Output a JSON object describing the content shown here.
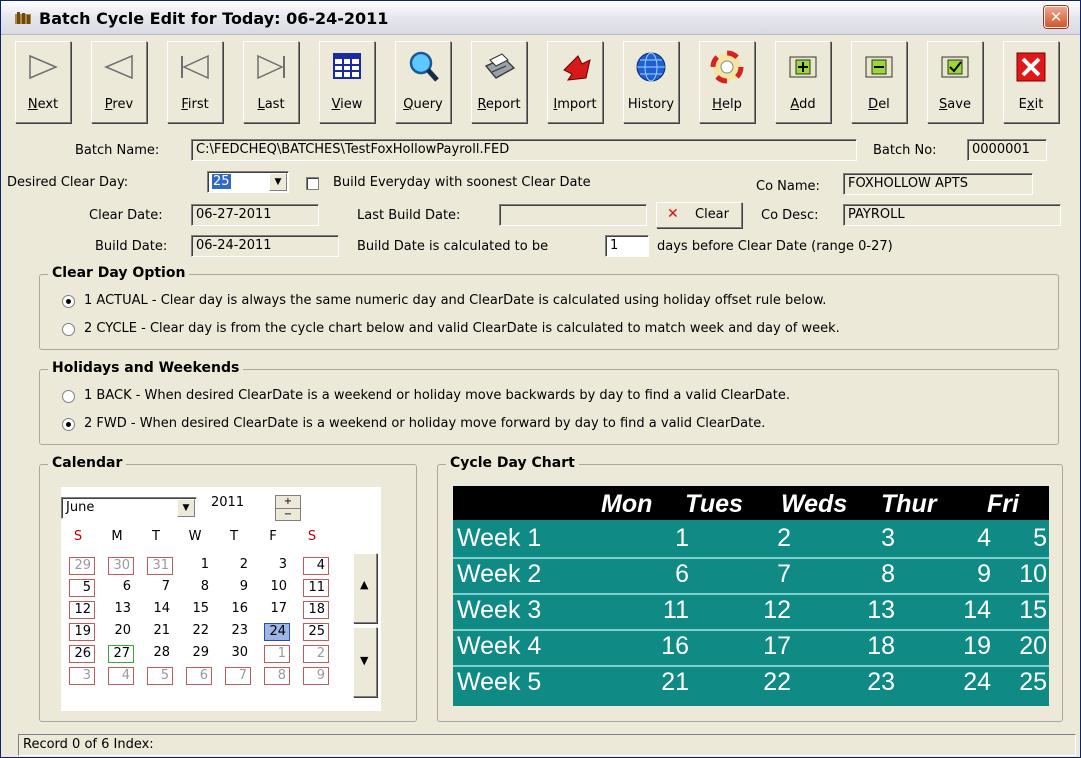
{
  "window": {
    "title": "Batch Cycle Edit for Today: 06-24-2011",
    "close_glyph": "✕"
  },
  "toolbar": [
    {
      "key": "N",
      "rest": "ext",
      "icon": "next-icon"
    },
    {
      "key": "P",
      "rest": "rev",
      "icon": "prev-icon"
    },
    {
      "key": "F",
      "rest": "irst",
      "icon": "first-icon"
    },
    {
      "key": "L",
      "rest": "ast",
      "icon": "last-icon"
    },
    {
      "key": "V",
      "rest": "iew",
      "icon": "grid-view-icon"
    },
    {
      "key": "Q",
      "rest": "uery",
      "icon": "magnifier-icon"
    },
    {
      "key": "R",
      "rest": "eport",
      "icon": "printer-icon"
    },
    {
      "key": "I",
      "rest": "mport",
      "icon": "import-arrow-icon"
    },
    {
      "key": "",
      "rest": "History",
      "icon": "globe-icon"
    },
    {
      "key": "H",
      "rest": "elp",
      "icon": "lifebuoy-icon"
    },
    {
      "key": "A",
      "rest": "dd",
      "icon": "add-folder-icon"
    },
    {
      "key": "D",
      "rest": "el",
      "icon": "delete-folder-icon"
    },
    {
      "key": "S",
      "rest": "ave",
      "icon": "save-check-icon"
    },
    {
      "pre": "E",
      "key": "x",
      "rest": "it",
      "icon": "exit-x-icon"
    }
  ],
  "form": {
    "batch_name_label": "Batch Name:",
    "batch_name": "C:\\FEDCHEQ\\BATCHES\\TestFoxHollowPayroll.FED",
    "batch_no_label": "Batch No:",
    "batch_no": "0000001",
    "desired_clear_day_label": "Desired Clear Day:",
    "desired_clear_day": "25",
    "build_everyday_label": "Build Everyday with soonest Clear Date",
    "co_name_label": "Co Name:",
    "co_name": "FOXHOLLOW APTS",
    "clear_date_label": "Clear Date:",
    "clear_date": "06-27-2011",
    "last_build_date_label": "Last Build Date:",
    "last_build_date": "",
    "clear_button": "Clear",
    "co_desc_label": "Co Desc:",
    "co_desc": "PAYROLL",
    "build_date_label": "Build Date:",
    "build_date": "06-24-2011",
    "build_calc_label": "Build Date is calculated to be",
    "build_days": "1",
    "build_days_suffix": "days before Clear Date (range 0-27)"
  },
  "clear_day_option": {
    "title": "Clear Day Option",
    "options": [
      {
        "text": "1 ACTUAL - Clear day is always the same numeric day and ClearDate is calculated using holiday offset rule below.",
        "selected": true
      },
      {
        "text": "2 CYCLE - Clear day is from the cycle chart below and valid ClearDate is calculated to match week and day of week.",
        "selected": false
      }
    ]
  },
  "holidays": {
    "title": "Holidays and Weekends",
    "options": [
      {
        "text": "1 BACK - When desired ClearDate is a weekend or holiday move backwards by day to find a valid ClearDate.",
        "selected": false
      },
      {
        "text": "2 FWD - When desired ClearDate is a weekend or holiday move forward by day to find a valid ClearDate.",
        "selected": true
      }
    ]
  },
  "calendar": {
    "title": "Calendar",
    "month": "June",
    "year": "2011",
    "day_headers": [
      "S",
      "M",
      "T",
      "W",
      "T",
      "F",
      "S"
    ],
    "weeks": [
      [
        "29",
        "30",
        "31",
        "1",
        "2",
        "3",
        "4"
      ],
      [
        "5",
        "6",
        "7",
        "8",
        "9",
        "10",
        "11"
      ],
      [
        "12",
        "13",
        "14",
        "15",
        "16",
        "17",
        "18"
      ],
      [
        "19",
        "20",
        "21",
        "22",
        "23",
        "24",
        "25"
      ],
      [
        "26",
        "27",
        "28",
        "29",
        "30",
        "1",
        "2"
      ],
      [
        "3",
        "4",
        "5",
        "6",
        "7",
        "8",
        "9"
      ]
    ],
    "selected": "24",
    "today": "27"
  },
  "cycle_chart": {
    "title": "Cycle Day Chart",
    "headers": [
      "Mon",
      "Tues",
      "Weds",
      "Thur",
      "Fri"
    ],
    "rows": [
      {
        "label": "Week 1",
        "values": [
          "1",
          "2",
          "3",
          "4",
          "5"
        ]
      },
      {
        "label": "Week 2",
        "values": [
          "6",
          "7",
          "8",
          "9",
          "10"
        ]
      },
      {
        "label": "Week 3",
        "values": [
          "11",
          "12",
          "13",
          "14",
          "15"
        ]
      },
      {
        "label": "Week 4",
        "values": [
          "16",
          "17",
          "18",
          "19",
          "20"
        ]
      },
      {
        "label": "Week 5",
        "values": [
          "21",
          "22",
          "23",
          "24",
          "25"
        ]
      }
    ]
  },
  "status": "Record 0 of 6 Index:"
}
